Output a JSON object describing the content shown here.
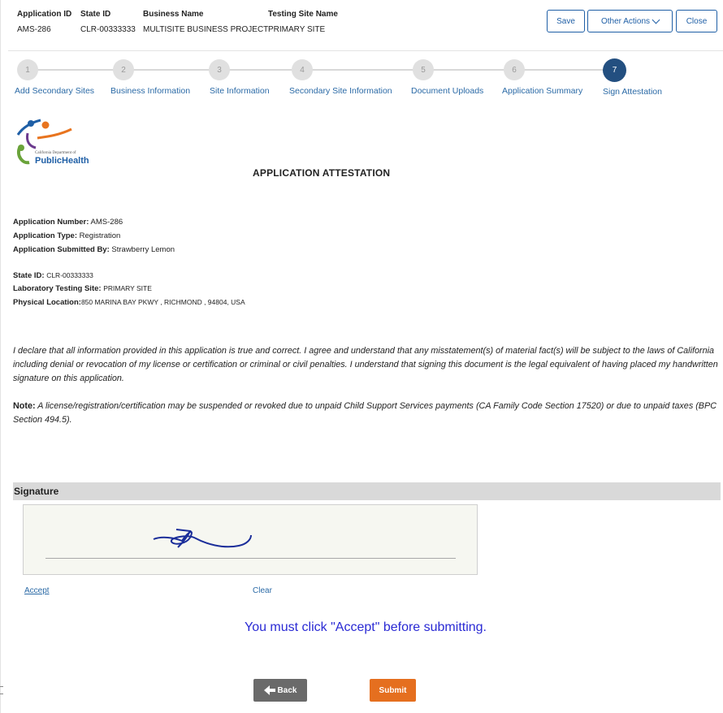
{
  "header": {
    "application_id_label": "Application ID",
    "application_id": "AMS-286",
    "state_id_label": "State ID",
    "state_id": "CLR-00333333",
    "business_name_label": "Business Name",
    "business_name": "MULTISITE BUSINESS PROJECT",
    "testing_site_label": "Testing Site Name",
    "testing_site": "PRIMARY SITE",
    "save_label": "Save",
    "other_actions_label": "Other Actions",
    "close_label": "Close"
  },
  "steps": [
    {
      "number": "1",
      "label": "Add Secondary Sites"
    },
    {
      "number": "2",
      "label": "Business Information"
    },
    {
      "number": "3",
      "label": "Site Information"
    },
    {
      "number": "4",
      "label": "Secondary Site Information"
    },
    {
      "number": "5",
      "label": "Document Uploads"
    },
    {
      "number": "6",
      "label": "Application Summary"
    },
    {
      "number": "7",
      "label": "Sign Attestation"
    }
  ],
  "active_step": 7,
  "logo": {
    "line1": "California Department of",
    "line2": "PublicHealth"
  },
  "title": "APPLICATION ATTESTATION",
  "info": {
    "app_number_label": "Application Number:",
    "app_number": "AMS-286",
    "app_type_label": "Application Type:",
    "app_type": "Registration",
    "submitted_by_label": "Application Submitted By:",
    "submitted_by": "Strawberry Lemon",
    "state_id_label": "State ID:",
    "state_id": "CLR-00333333",
    "lab_site_label": "Laboratory Testing Site:",
    "lab_site": "PRIMARY SITE",
    "location_label": "Physical Location:",
    "location": "850 MARINA BAY PKWY , RICHMOND , 94804, USA"
  },
  "declaration": "I declare that all information provided in this application is true and correct. I agree and understand that any misstatement(s) of material fact(s) will be subject to the laws of California including denial or revocation of my license or certification or criminal or civil penalties. I understand that signing this document is the legal equivalent of having placed my handwritten signature on this application.",
  "note_label": "Note:",
  "note": "A license/registration/certification may be suspended or revoked due to unpaid Child Support Services payments (CA Family Code Section 17520) or due to unpaid taxes (BPC Section 494.5).",
  "signature": {
    "heading": "Signature",
    "accept_label": "Accept",
    "clear_label": "Clear"
  },
  "warning": "You must click \"Accept\" before submitting.",
  "buttons": {
    "back_label": "Back",
    "submit_label": "Submit"
  },
  "colors": {
    "link": "#2b6aa6",
    "active_step": "#234f80",
    "submit": "#e56f1f",
    "back": "#6a6a6a",
    "warning": "#2a2ad4"
  }
}
